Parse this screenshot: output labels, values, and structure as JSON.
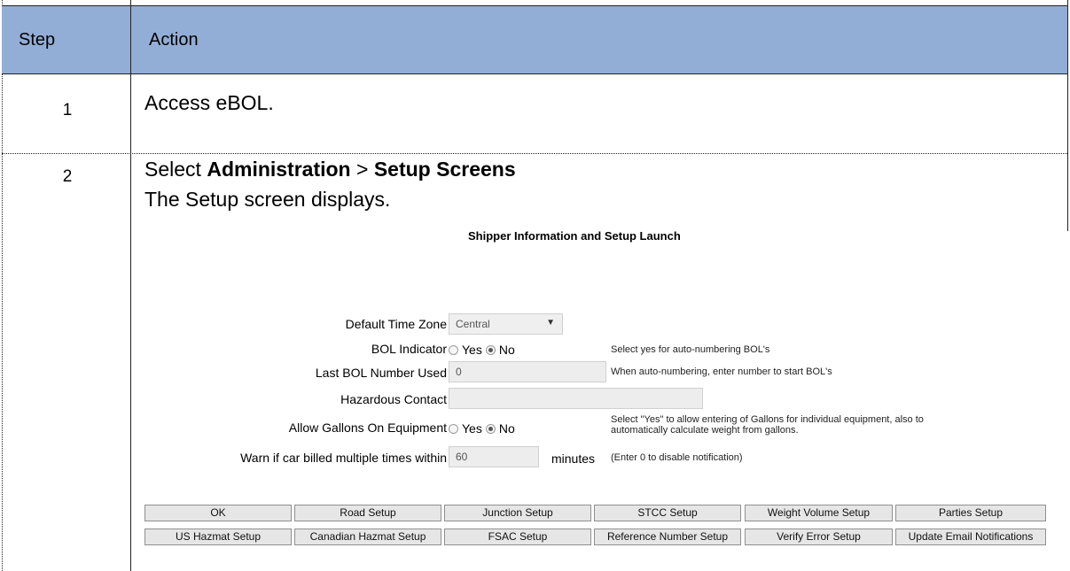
{
  "header": {
    "step": "Step",
    "action": "Action"
  },
  "rows": [
    {
      "step": "1",
      "text": "Access eBOL."
    },
    {
      "step": "2",
      "select_prefix": "Select ",
      "menu": "Administration",
      "sep": " > ",
      "submenu": "Setup Screens",
      "result": "The Setup screen displays."
    }
  ],
  "setup": {
    "title": "Shipper Information and Setup Launch",
    "time_zone": {
      "label": "Default Time Zone",
      "value": "Central",
      "hint": ""
    },
    "bol_indicator": {
      "label": "BOL Indicator",
      "yes": "Yes",
      "no": "No",
      "selected": "No",
      "hint": "Select yes for auto-numbering BOL's"
    },
    "last_bol": {
      "label": "Last BOL Number Used",
      "value": "0",
      "hint": "When auto-numbering, enter number to start BOL's"
    },
    "hazardous_contact": {
      "label": "Hazardous Contact",
      "value": ""
    },
    "allow_gallons": {
      "label": "Allow Gallons On Equipment",
      "yes": "Yes",
      "no": "No",
      "selected": "No",
      "hint_line1": "Select \"Yes\" to allow entering of Gallons for individual equipment, also to",
      "hint_line2": "automatically calculate weight from gallons."
    },
    "warn": {
      "label": "Warn if car billed multiple times within",
      "value": "60",
      "unit": "minutes",
      "hint": "(Enter 0 to disable notification)"
    },
    "buttons_row1": [
      "OK",
      "Road Setup",
      "Junction Setup",
      "STCC Setup",
      "Weight Volume Setup",
      "Parties Setup"
    ],
    "buttons_row2": [
      "US Hazmat Setup",
      "Canadian Hazmat Setup",
      "FSAC Setup",
      "Reference Number Setup",
      "Verify Error Setup",
      "Update Email Notifications"
    ]
  }
}
